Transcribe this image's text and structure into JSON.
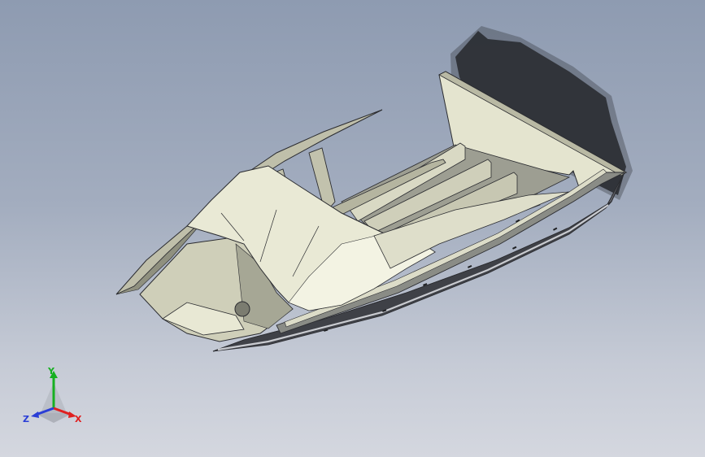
{
  "viewport": {
    "model_name": "",
    "colors": {
      "background_top": "#8e9bb1",
      "background_bottom": "#d4d7df",
      "hull_light": "#e6e6d2",
      "hull_mid": "#c9c9b4",
      "hull_dark": "#5b5d63",
      "edge": "#2b2c30",
      "shadow": "#2d3036"
    }
  },
  "triad": {
    "x_label": "X",
    "y_label": "Y",
    "z_label": "Z",
    "x_color": "#e02020",
    "y_color": "#16b021",
    "z_color": "#2a3ed6",
    "icon": "view-orientation-triad-icon"
  }
}
